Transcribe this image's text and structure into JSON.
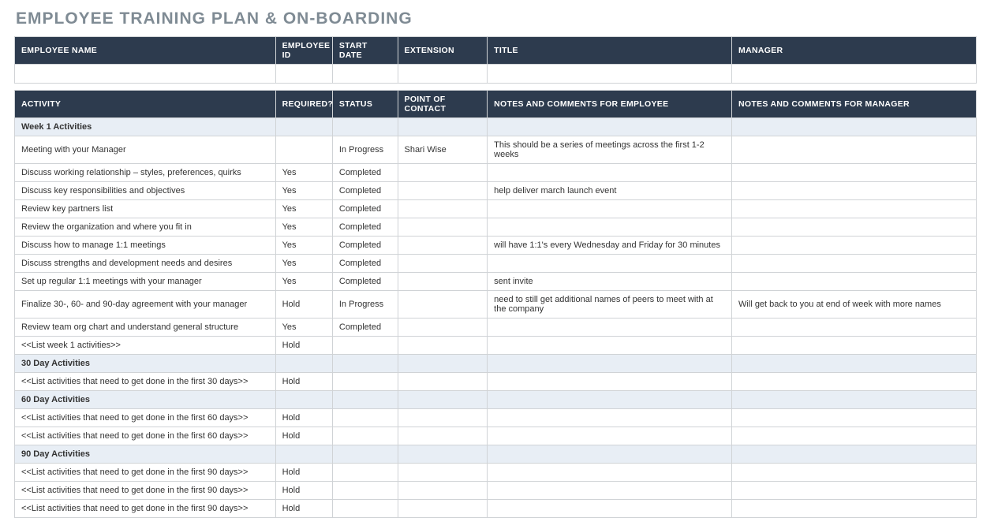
{
  "title": "EMPLOYEE TRAINING PLAN & ON-BOARDING",
  "empHeader": {
    "name": "EMPLOYEE NAME",
    "id": "EMPLOYEE ID",
    "startDate": "START DATE",
    "extension": "EXTENSION",
    "title": "TITLE",
    "manager": "MANAGER"
  },
  "actHeader": {
    "activity": "ACTIVITY",
    "required": "REQUIRED?",
    "status": "STATUS",
    "contact": "POINT OF CONTACT",
    "empNotes": "NOTES AND COMMENTS FOR EMPLOYEE",
    "mgrNotes": "NOTES AND COMMENTS FOR MANAGER"
  },
  "sections": [
    {
      "label": "Week 1 Activities",
      "rows": [
        {
          "activity": "Meeting with your Manager",
          "required": "",
          "status": "In Progress",
          "contact": "Shari Wise",
          "empNotes": "This should be a series of meetings across the first 1-2 weeks",
          "mgrNotes": ""
        },
        {
          "activity": "Discuss working relationship – styles, preferences, quirks",
          "required": "Yes",
          "status": "Completed",
          "contact": "",
          "empNotes": "",
          "mgrNotes": ""
        },
        {
          "activity": "Discuss key responsibilities and objectives",
          "required": "Yes",
          "status": "Completed",
          "contact": "",
          "empNotes": "help deliver march launch event",
          "mgrNotes": ""
        },
        {
          "activity": "Review key partners list",
          "required": "Yes",
          "status": "Completed",
          "contact": "",
          "empNotes": "",
          "mgrNotes": ""
        },
        {
          "activity": "Review the organization and where you fit in",
          "required": "Yes",
          "status": "Completed",
          "contact": "",
          "empNotes": "",
          "mgrNotes": ""
        },
        {
          "activity": "Discuss how to manage 1:1 meetings",
          "required": "Yes",
          "status": "Completed",
          "contact": "",
          "empNotes": "will have 1:1's every Wednesday and Friday for 30 minutes",
          "mgrNotes": ""
        },
        {
          "activity": "Discuss strengths and development needs and desires",
          "required": "Yes",
          "status": "Completed",
          "contact": "",
          "empNotes": "",
          "mgrNotes": ""
        },
        {
          "activity": "Set up regular 1:1 meetings with your manager",
          "required": "Yes",
          "status": "Completed",
          "contact": "",
          "empNotes": "sent invite",
          "mgrNotes": ""
        },
        {
          "activity": "Finalize 30-, 60- and 90-day agreement with your manager",
          "required": "Hold",
          "status": "In Progress",
          "contact": "",
          "empNotes": "need to still get additional names of peers to meet with at the company",
          "mgrNotes": "Will get back to you at end of week with more names"
        },
        {
          "activity": "Review team org chart and understand general structure",
          "required": "Yes",
          "status": "Completed",
          "contact": "",
          "empNotes": "",
          "mgrNotes": ""
        },
        {
          "activity": "<<List week 1 activities>>",
          "required": "Hold",
          "status": "",
          "contact": "",
          "empNotes": "",
          "mgrNotes": ""
        }
      ]
    },
    {
      "label": "30 Day Activities",
      "rows": [
        {
          "activity": "<<List activities that need to get done in the first 30 days>>",
          "required": "Hold",
          "status": "",
          "contact": "",
          "empNotes": "",
          "mgrNotes": ""
        }
      ]
    },
    {
      "label": "60 Day Activities",
      "rows": [
        {
          "activity": "<<List activities that need to get done in the first 60 days>>",
          "required": "Hold",
          "status": "",
          "contact": "",
          "empNotes": "",
          "mgrNotes": ""
        },
        {
          "activity": "<<List activities that need to get done in the first 60 days>>",
          "required": "Hold",
          "status": "",
          "contact": "",
          "empNotes": "",
          "mgrNotes": ""
        }
      ]
    },
    {
      "label": "90 Day Activities",
      "rows": [
        {
          "activity": "<<List activities that need to get done in the first 90 days>>",
          "required": "Hold",
          "status": "",
          "contact": "",
          "empNotes": "",
          "mgrNotes": ""
        },
        {
          "activity": "<<List activities that need to get done in the first 90 days>>",
          "required": "Hold",
          "status": "",
          "contact": "",
          "empNotes": "",
          "mgrNotes": ""
        },
        {
          "activity": "<<List activities that need to get done in the first 90 days>>",
          "required": "Hold",
          "status": "",
          "contact": "",
          "empNotes": "",
          "mgrNotes": ""
        }
      ]
    }
  ]
}
